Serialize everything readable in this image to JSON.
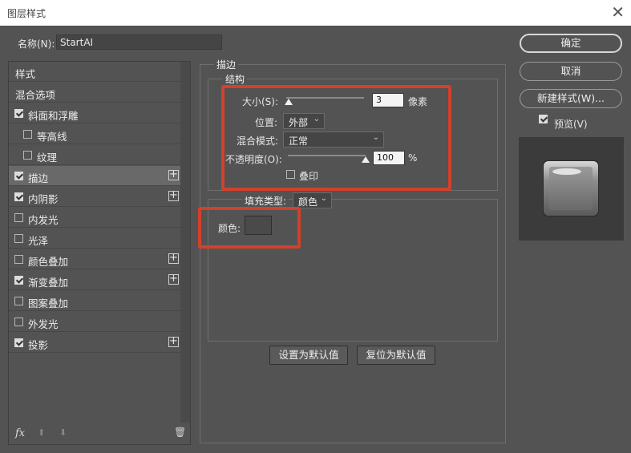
{
  "window": {
    "title": "图层样式",
    "close_icon": "close-icon"
  },
  "name_field": {
    "label": "名称(N):",
    "value": "StartAI"
  },
  "styles_panel": {
    "header": "样式",
    "items": [
      {
        "label": "混合选项",
        "checkbox": false,
        "checked": false,
        "add": false,
        "indent": false
      },
      {
        "label": "斜面和浮雕",
        "checkbox": true,
        "checked": true,
        "add": false,
        "indent": false
      },
      {
        "label": "等高线",
        "checkbox": true,
        "checked": false,
        "add": false,
        "indent": true
      },
      {
        "label": "纹理",
        "checkbox": true,
        "checked": false,
        "add": false,
        "indent": true
      },
      {
        "label": "描边",
        "checkbox": true,
        "checked": true,
        "add": true,
        "indent": false,
        "selected": true
      },
      {
        "label": "内阴影",
        "checkbox": true,
        "checked": true,
        "add": true,
        "indent": false
      },
      {
        "label": "内发光",
        "checkbox": true,
        "checked": false,
        "add": false,
        "indent": false
      },
      {
        "label": "光泽",
        "checkbox": true,
        "checked": false,
        "add": false,
        "indent": false
      },
      {
        "label": "颜色叠加",
        "checkbox": true,
        "checked": false,
        "add": true,
        "indent": false
      },
      {
        "label": "渐变叠加",
        "checkbox": true,
        "checked": true,
        "add": true,
        "indent": false
      },
      {
        "label": "图案叠加",
        "checkbox": true,
        "checked": false,
        "add": false,
        "indent": false
      },
      {
        "label": "外发光",
        "checkbox": true,
        "checked": false,
        "add": false,
        "indent": false
      },
      {
        "label": "投影",
        "checkbox": true,
        "checked": true,
        "add": true,
        "indent": false
      }
    ],
    "footer": {
      "fx": "fx",
      "add_icon": "plus-icon",
      "up_icon": "arrow-up-icon",
      "down_icon": "arrow-down-icon",
      "trash_icon": "trash-icon"
    }
  },
  "stroke": {
    "section_title": "描边",
    "structure_title": "结构",
    "size": {
      "label": "大小(S):",
      "value": "3",
      "unit": "像素",
      "slider_level": 0.03
    },
    "position": {
      "label": "位置:",
      "value": "外部"
    },
    "blend_mode": {
      "label": "混合模式:",
      "value": "正常"
    },
    "opacity": {
      "label": "不透明度(O):",
      "value": "100",
      "unit": "%",
      "slider_level": 1.0
    },
    "overprint": {
      "label": "叠印",
      "checked": false
    },
    "fill_type": {
      "label": "填充类型:",
      "value": "颜色"
    },
    "color": {
      "label": "颜色:",
      "swatch": "#4a4a4a"
    },
    "buttons": {
      "set_default": "设置为默认值",
      "reset_default": "复位为默认值"
    }
  },
  "actions": {
    "ok": "确定",
    "cancel": "取消",
    "new_style": "新建样式(W)...",
    "preview_label": "预览(V)",
    "preview_checked": true
  },
  "colors": {
    "highlight": "#d2412b",
    "panel": "#535353"
  }
}
